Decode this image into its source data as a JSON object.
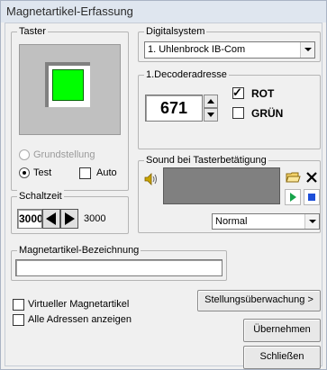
{
  "window": {
    "title": "Magnetartikel-Erfassung"
  },
  "taster": {
    "group_label": "Taster",
    "indicator_color": "#00ff00",
    "grundstellung_label": "Grundstellung",
    "test_label": "Test",
    "auto_label": "Auto",
    "mode_selected": "Test"
  },
  "schaltzeit": {
    "group_label": "Schaltzeit",
    "value": "3000",
    "display": "3000"
  },
  "digitalsystem": {
    "group_label": "Digitalsystem",
    "selected": "1. Uhlenbrock IB-Com"
  },
  "decoder": {
    "group_label": "1.Decoderadresse",
    "address": "671",
    "rot_label": "ROT",
    "rot_checked": true,
    "gruen_label": "GRÜN",
    "gruen_checked": false
  },
  "sound": {
    "group_label": "Sound bei Tasterbetätigung",
    "mode_selected": "Normal",
    "icons": [
      "speaker-icon",
      "folder-icon",
      "delete-icon",
      "play-icon",
      "stop-icon"
    ]
  },
  "bezeichnung": {
    "group_label": "Magnetartikel-Bezeichnung",
    "value": ""
  },
  "options": {
    "virtuell_label": "Virtueller Magnetartikel",
    "alle_adressen_label": "Alle Adressen anzeigen"
  },
  "buttons": {
    "stellung": "Stellungsüberwachung >",
    "uebernehmen": "Übernehmen",
    "schliessen": "Schließen"
  }
}
